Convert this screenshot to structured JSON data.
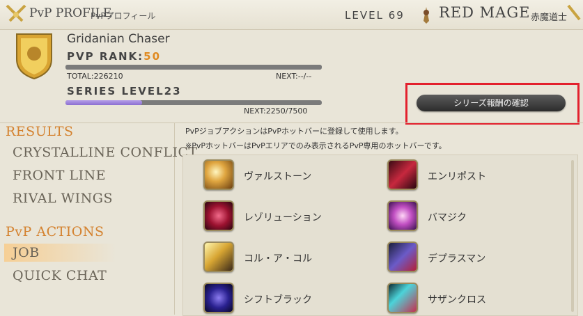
{
  "header": {
    "title": "PvP PROFILE",
    "subtitle": "PvPプロフィール",
    "level_label": "LEVEL 69",
    "job_name": "RED MAGE",
    "job_name_jp": "赤魔道士"
  },
  "profile": {
    "player_name": "Gridanian Chaser",
    "rank_label": "PVP RANK:",
    "rank_value": "50",
    "total": "TOTAL:226210",
    "next_rank": "NEXT:--/--",
    "rank_progress": 1.0,
    "series_label": "SERIES LEVEL23",
    "series_next": "NEXT:2250/7500",
    "series_progress": 0.3
  },
  "confirm_button": "シリーズ報酬の確認",
  "menu": {
    "results_header": "RESULTS",
    "results_items": [
      "CRYSTALLINE CONFLICT",
      "FRONT LINE",
      "RIVAL WINGS"
    ],
    "actions_header": "PvP ACTIONS",
    "actions_items": [
      "JOB",
      "QUICK CHAT"
    ]
  },
  "notes": [
    "PvPジョブアクションはPvPホットバーに登録して使用します。",
    "※PvPホットバーはPvPエリアでのみ表示されるPvP専用のホットバーです。"
  ],
  "actions": [
    {
      "name": "ヴァルストーン",
      "icon": "verstone-icon"
    },
    {
      "name": "エンリポスト",
      "icon": "enchanted-riposte-icon"
    },
    {
      "name": "レゾリューション",
      "icon": "resolution-icon"
    },
    {
      "name": "バマジク",
      "icon": "magick-barrier-icon"
    },
    {
      "name": "コル・ア・コル",
      "icon": "corps-a-corps-icon"
    },
    {
      "name": "デプラスマン",
      "icon": "displacement-icon"
    },
    {
      "name": "シフトブラック",
      "icon": "black-shift-icon"
    },
    {
      "name": "サザンクロス",
      "icon": "southern-cross-icon"
    }
  ],
  "colors": {
    "accent_orange": "#d4822f",
    "highlight_red": "#e3202d",
    "series_bar": "#8b6ed1"
  }
}
